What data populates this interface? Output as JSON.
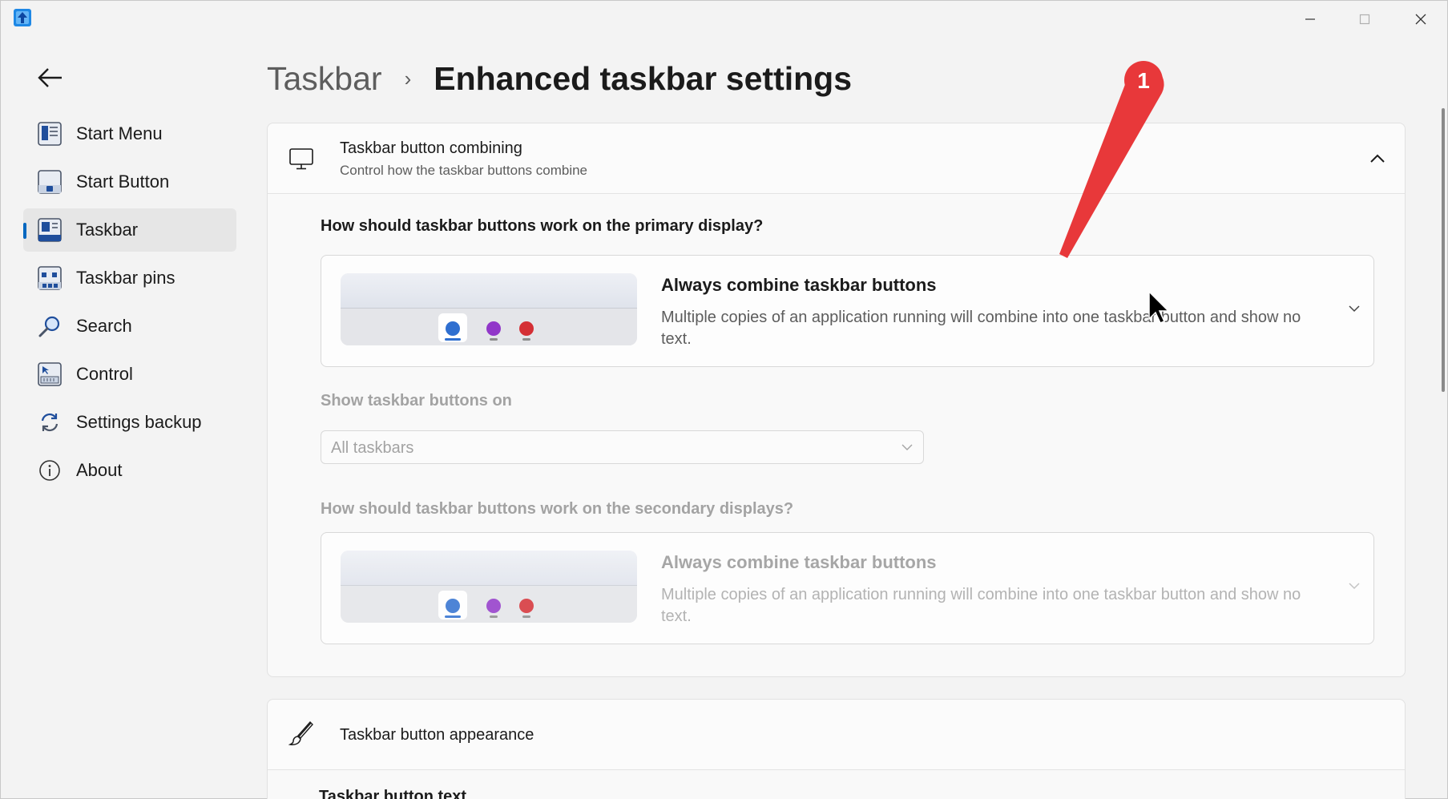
{
  "window": {
    "app_icon": "app-logo-icon",
    "controls": {
      "minimize": "minimize-icon",
      "maximize": "maximize-icon",
      "close": "close-icon"
    }
  },
  "sidebar": {
    "back_icon": "back-arrow-icon",
    "items": [
      {
        "label": "Start Menu",
        "icon": "start-menu-icon",
        "active": false
      },
      {
        "label": "Start Button",
        "icon": "start-button-icon",
        "active": false
      },
      {
        "label": "Taskbar",
        "icon": "taskbar-icon",
        "active": true
      },
      {
        "label": "Taskbar pins",
        "icon": "taskbar-pins-icon",
        "active": false
      },
      {
        "label": "Search",
        "icon": "search-icon",
        "active": false
      },
      {
        "label": "Control",
        "icon": "control-icon",
        "active": false
      },
      {
        "label": "Settings backup",
        "icon": "settings-backup-icon",
        "active": false
      },
      {
        "label": "About",
        "icon": "info-icon",
        "active": false
      }
    ]
  },
  "header": {
    "parent": "Taskbar",
    "separator": "›",
    "current": "Enhanced taskbar settings"
  },
  "combining": {
    "title": "Taskbar button combining",
    "subtitle": "Control how the taskbar buttons combine",
    "primary_question": "How should taskbar buttons work on the primary display?",
    "primary_option": {
      "title": "Always combine taskbar buttons",
      "description": "Multiple copies of an application running will combine into one taskbar button and show no text."
    },
    "show_on_label": "Show taskbar buttons on",
    "show_on_value": "All taskbars",
    "secondary_question": "How should taskbar buttons work on the secondary displays?",
    "secondary_option": {
      "title": "Always combine taskbar buttons",
      "description": "Multiple copies of an application running will combine into one taskbar button and show no text."
    },
    "preview_colors": {
      "blue": "#2f6fd0",
      "purple": "#9137c9",
      "red": "#d42f35"
    }
  },
  "appearance": {
    "title": "Taskbar button appearance",
    "sub_heading": "Taskbar button text"
  },
  "annotation": {
    "number": "1",
    "color": "#e8383a"
  },
  "accent_color": "#0067c0"
}
